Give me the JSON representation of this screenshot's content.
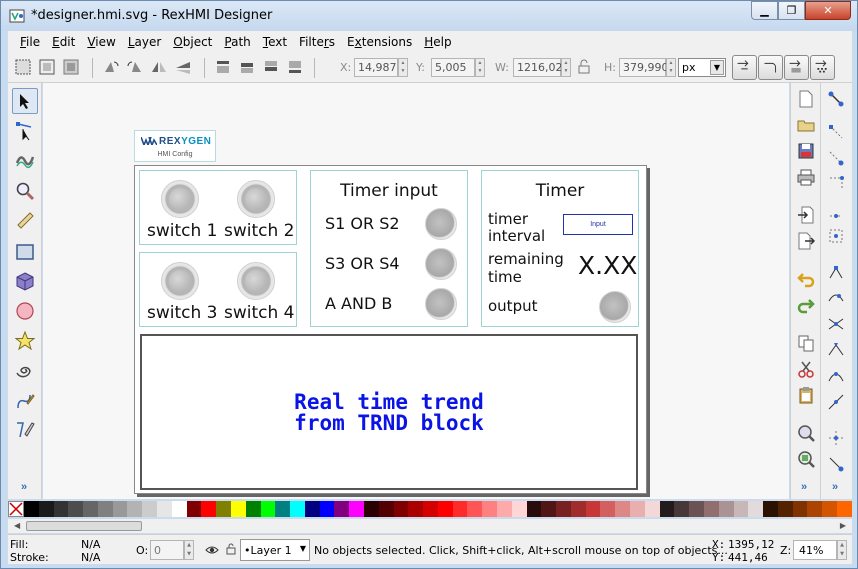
{
  "window": {
    "title": "*designer.hmi.svg - RexHMI Designer"
  },
  "menu": [
    {
      "label": "File",
      "ul": "F"
    },
    {
      "label": "Edit",
      "ul": "E"
    },
    {
      "label": "View",
      "ul": "V"
    },
    {
      "label": "Layer",
      "ul": "L"
    },
    {
      "label": "Object",
      "ul": "O"
    },
    {
      "label": "Path",
      "ul": "P"
    },
    {
      "label": "Text",
      "ul": "T"
    },
    {
      "label": "Filters",
      "ul": "r"
    },
    {
      "label": "Extensions",
      "ul": "x"
    },
    {
      "label": "Help",
      "ul": "H"
    }
  ],
  "controls": {
    "x_label": "X:",
    "x_value": "14,987",
    "y_label": "Y:",
    "y_value": "5,005",
    "w_label": "W:",
    "w_value": "1216,02",
    "h_label": "H:",
    "h_value": "379,990",
    "unit": "px"
  },
  "hmi": {
    "logo_brand_a": "REX",
    "logo_brand_b": "YGEN",
    "logo_sub": "HMI Config",
    "switches": {
      "s1": "switch 1",
      "s2": "switch 2",
      "s3": "switch 3",
      "s4": "switch 4"
    },
    "timer_input": {
      "title": "Timer input",
      "row1": "S1 OR S2",
      "row2": "S3 OR S4",
      "row3": "A AND B"
    },
    "timer": {
      "title": "Timer",
      "interval_label_1": "timer",
      "interval_label_2": "interval",
      "input_placeholder": "Input",
      "remaining_label_1": "remaining",
      "remaining_label_2": "time",
      "remaining_value": "X.XX",
      "output_label": "output"
    },
    "trend": {
      "line1": "Real time trend",
      "line2": "from TRND block"
    }
  },
  "statusbar": {
    "fill_label": "Fill:",
    "fill_value": "N/A",
    "stroke_label": "Stroke:",
    "stroke_value": "N/A",
    "opacity_label": "O:",
    "opacity_value": "0",
    "layer": "•Layer 1",
    "message": "No objects selected. Click, Shift+click, Alt+scroll mouse on top of objects...",
    "x_label": "X:",
    "x_value": "1395,12",
    "y_label": "Y:",
    "y_value": "441,46",
    "zoom_label": "Z:",
    "zoom_value": "41%"
  },
  "palette_colors": [
    "#000000",
    "#1a1a1a",
    "#333333",
    "#4d4d4d",
    "#666666",
    "#808080",
    "#999999",
    "#b3b3b3",
    "#cccccc",
    "#e6e6e6",
    "#ffffff",
    "#800000",
    "#ff0000",
    "#808000",
    "#ffff00",
    "#008000",
    "#00ff00",
    "#008080",
    "#00ffff",
    "#000080",
    "#0000ff",
    "#800080",
    "#ff00ff",
    "#2b0000",
    "#550000",
    "#800000",
    "#aa0000",
    "#d40000",
    "#ff0000",
    "#ff2a2a",
    "#ff5555",
    "#ff8080",
    "#ffaaaa",
    "#ffd5d5",
    "#280b0b",
    "#501616",
    "#782121",
    "#a02c2c",
    "#c83737",
    "#d35f5f",
    "#de8787",
    "#e9afaf",
    "#f4d7d7",
    "#241c1c",
    "#483737",
    "#6c5353",
    "#916f6f",
    "#ac9393",
    "#c8b7b7",
    "#e3dbdb",
    "#2b1100",
    "#552200",
    "#803300",
    "#aa4400",
    "#d45500",
    "#ff6600"
  ]
}
